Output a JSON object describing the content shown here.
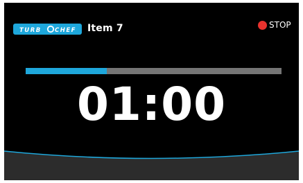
{
  "header": {
    "logo_text": "TURBOCHEF",
    "item_title": "Item 7"
  },
  "controls": {
    "stop_label": "STOP"
  },
  "progress": {
    "fraction": 0.316
  },
  "timer": {
    "remaining": "01:00"
  },
  "colors": {
    "panel_background": "#000000",
    "accent_blue": "#1ea7db",
    "progress_track": "#757575",
    "stop_red": "#e8322d",
    "bottom_bar": "#2c2c2c"
  }
}
